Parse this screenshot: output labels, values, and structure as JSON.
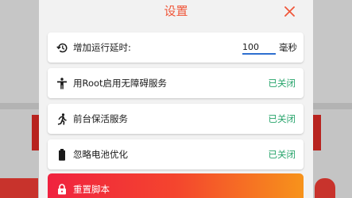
{
  "dialog": {
    "title": "设置",
    "close_icon": "close-icon",
    "accent": "#f0573a"
  },
  "delay_row": {
    "icon": "history-icon",
    "label": "增加运行延时:",
    "value": "100",
    "unit": "毫秒"
  },
  "settings": [
    {
      "icon": "accessibility-icon",
      "label": "用Root启用无障碍服务",
      "status": "已关闭"
    },
    {
      "icon": "running-person-icon",
      "label": "前台保活服务",
      "status": "已关闭"
    },
    {
      "icon": "battery-icon",
      "label": "忽略电池优化",
      "status": "已关闭"
    }
  ],
  "reset": {
    "icon": "lock-icon",
    "label": "重置脚本"
  },
  "colors": {
    "status_green": "#25a36a",
    "input_underline": "#2e6fd0",
    "reset_gradient_start": "#f0223f",
    "reset_gradient_end": "#f7931b"
  }
}
